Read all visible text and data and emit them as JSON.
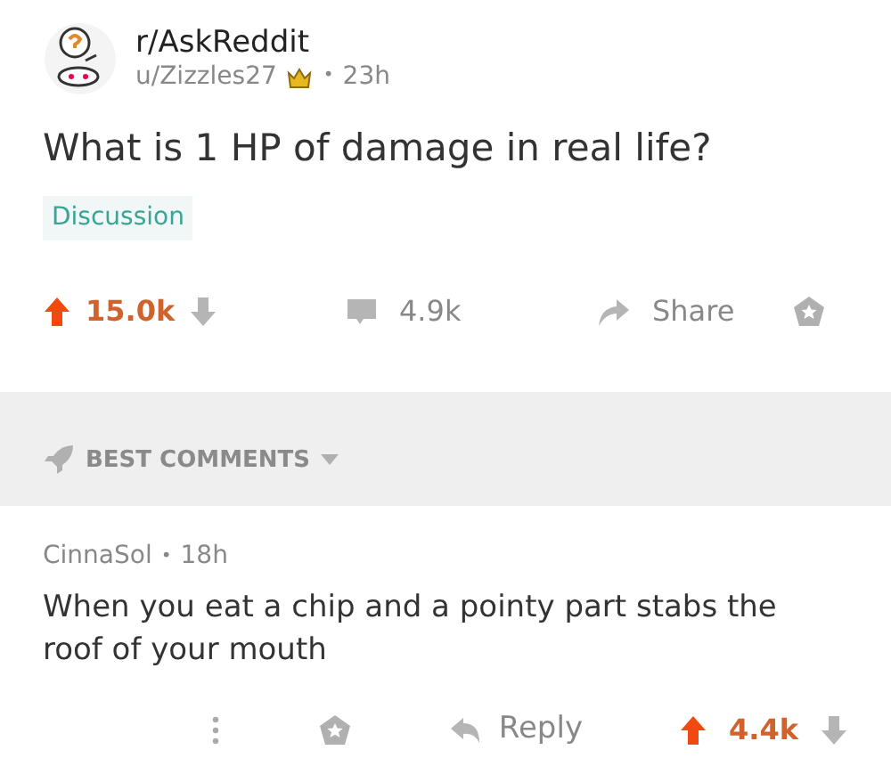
{
  "post": {
    "subreddit": "r/AskReddit",
    "author": "u/Zizzles27",
    "separator": "•",
    "age": "23h",
    "title": "What is 1 HP of damage in real life?",
    "flair": "Discussion",
    "score": "15.0k",
    "upvoted": true,
    "comments": "4.9k",
    "share": "Share"
  },
  "sort": {
    "label": "BEST COMMENTS"
  },
  "comments": [
    {
      "author": "CinnaSol",
      "separator": "•",
      "age": "18h",
      "body": "When you eat a chip and a pointy part stabs the roof of your mouth",
      "reply": "Reply",
      "score": "4.4k",
      "upvoted": true
    }
  ]
}
